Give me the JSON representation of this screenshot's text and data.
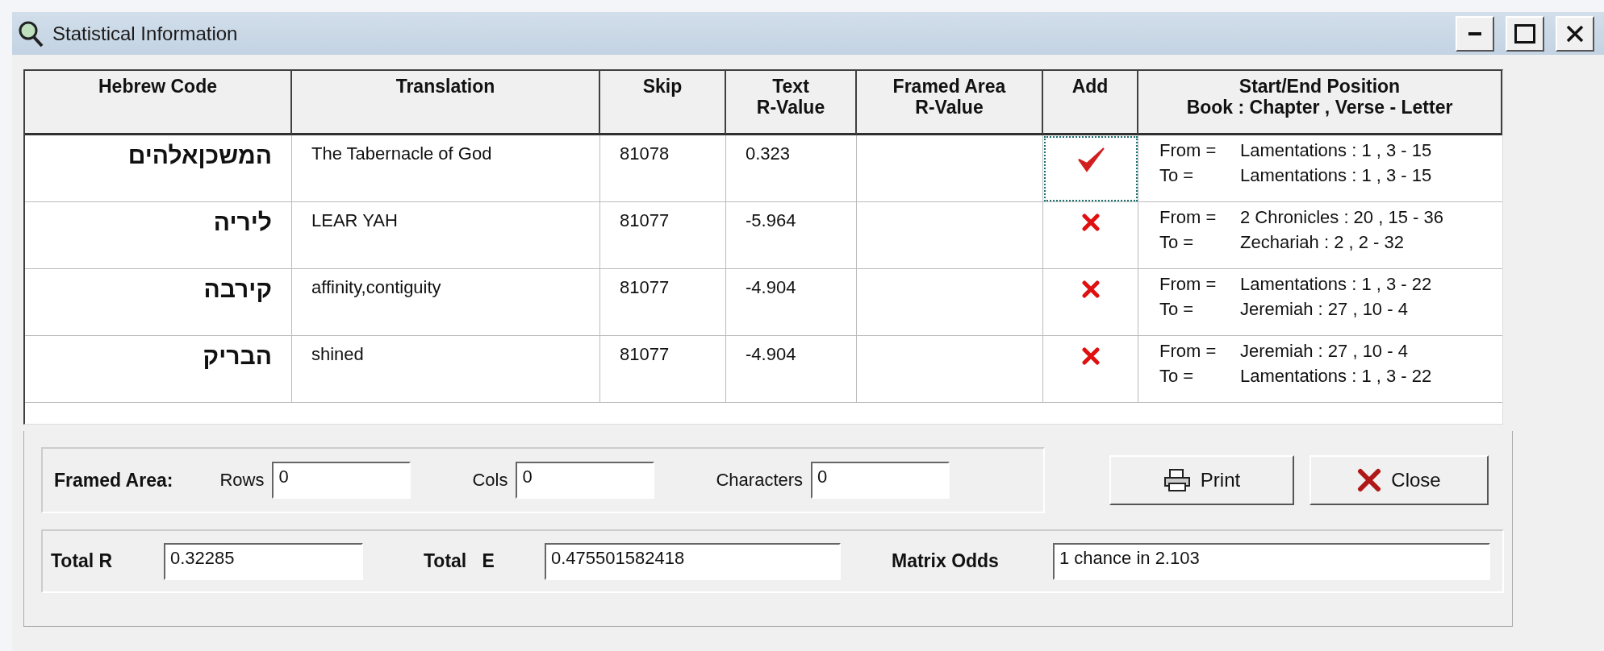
{
  "window": {
    "title": "Statistical Information"
  },
  "table": {
    "columns": [
      "Hebrew Code",
      "Translation",
      "Skip",
      "Text\nR-Value",
      "Framed Area\nR-Value",
      "Add",
      "Start/End Position\nBook : Chapter , Verse - Letter"
    ],
    "rows": [
      {
        "hebrew": "המשכןאלהים",
        "translation": "The Tabernacle of God",
        "skip": "81078",
        "text_r": "0.323",
        "add": true,
        "selected": true,
        "from_label": "From =",
        "from": "Lamentations : 1 , 3 - 15",
        "to_label": "To =",
        "to": "Lamentations : 1 , 3 - 15"
      },
      {
        "hebrew": "ליריה",
        "translation": "LEAR YAH",
        "skip": "81077",
        "text_r": "-5.964",
        "add": false,
        "selected": false,
        "from_label": "From =",
        "from": "2 Chronicles : 20 , 15 - 36",
        "to_label": "To =",
        "to": "Zechariah : 2 , 2 - 32"
      },
      {
        "hebrew": "קירבה",
        "translation": "affinity,contiguity",
        "skip": "81077",
        "text_r": "-4.904",
        "add": false,
        "selected": false,
        "from_label": "From =",
        "from": "Lamentations : 1 , 3 - 22",
        "to_label": "To =",
        "to": "Jeremiah : 27 , 10 - 4"
      },
      {
        "hebrew": "הבריק",
        "translation": "shined",
        "skip": "81077",
        "text_r": "-4.904",
        "add": false,
        "selected": false,
        "from_label": "From =",
        "from": "Jeremiah : 27 , 10 - 4",
        "to_label": "To =",
        "to": "Lamentations : 1 , 3 - 22"
      }
    ]
  },
  "framed_area": {
    "label": "Framed Area:",
    "fields": [
      {
        "label": "Rows",
        "value": "0"
      },
      {
        "label": "Cols",
        "value": "0"
      },
      {
        "label": "Characters",
        "value": "0"
      }
    ]
  },
  "buttons": [
    {
      "kind": "print",
      "label": "Print"
    },
    {
      "kind": "close",
      "label": "Close"
    }
  ],
  "totals": [
    {
      "label": "Total R",
      "value": "0.32285"
    },
    {
      "label": "Total   E",
      "value": "0.475501582418"
    },
    {
      "label": "Matrix Odds",
      "value": "1 chance in 2.103"
    }
  ]
}
